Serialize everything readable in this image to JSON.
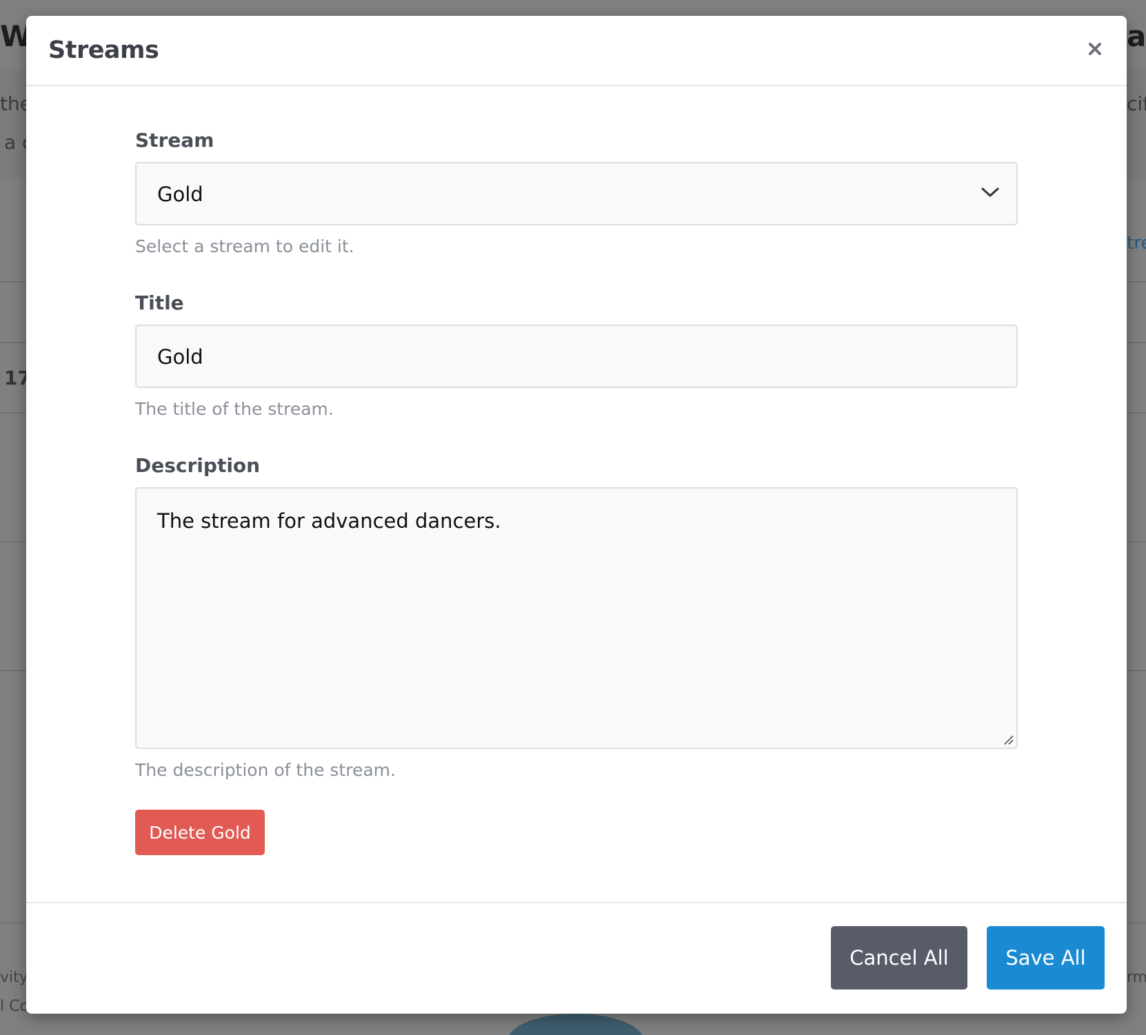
{
  "modal": {
    "title": "Streams",
    "close_icon": "close-icon"
  },
  "form": {
    "stream": {
      "label": "Stream",
      "selected": "Gold",
      "hint": "Select a stream to edit it."
    },
    "title": {
      "label": "Title",
      "value": "Gold",
      "hint": "The title of the stream."
    },
    "description": {
      "label": "Description",
      "value": "The stream for advanced dancers.",
      "hint": "The description of the stream."
    },
    "delete_label": "Delete Gold"
  },
  "footer": {
    "cancel_label": "Cancel All",
    "save_label": "Save All"
  },
  "background": {
    "frag_top_left": "Wl",
    "frag_top_right": "al",
    "frag_line1_left": "the",
    "frag_line1_right": "cif",
    "frag_line2_left": "a c",
    "frag_mid_right": "tre",
    "frag_num_left": "17",
    "frag_bottom_left1": "vity",
    "frag_bottom_left2": "l Co",
    "frag_bottom_right": "rm"
  },
  "colors": {
    "delete": "#e15a54",
    "cancel": "#575c68",
    "save": "#1a8bd2"
  }
}
